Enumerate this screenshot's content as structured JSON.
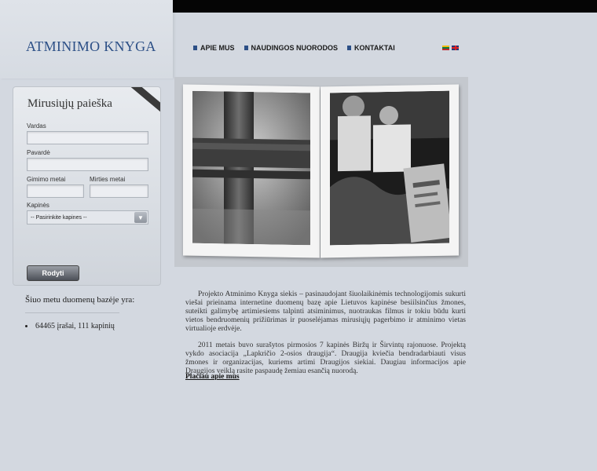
{
  "header": {
    "logo": "ATMINIMO KNYGA"
  },
  "nav": [
    {
      "label": "APIE MUS"
    },
    {
      "label": "NAUDINGOS NUORODOS"
    },
    {
      "label": "KONTAKTAI"
    }
  ],
  "languages": [
    "lt-flag-icon",
    "en-flag-icon"
  ],
  "search": {
    "title": "Mirusiųjų paieška",
    "fields": {
      "first_name_label": "Vardas",
      "last_name_label": "Pavardė",
      "birth_year_label": "Gimimo metai",
      "death_year_label": "Mirties metai",
      "cemetery_label": "Kapinės"
    },
    "cemetery_selected": "-- Pasirinkite kapines --",
    "submit_label": "Rodyti"
  },
  "stats": {
    "intro": "Šiuo metu duomenų bazėje yra:",
    "item": "64465 įrašai, 111 kapinių"
  },
  "content": {
    "paragraph1": "Projekto Atminimo Knyga siekis – pasinaudojant šiuolaikinėmis technologijomis sukurti viešai prieinama internetine duomenų bazę apie Lietuvos kapinėse besiilsinčius žmones, suteikti galimybę artimiesiems talpinti atsiminimus, nuotraukas filmus ir tokiu būdu kurti vietos bendruomenių prižiūrimas ir puoselėjamas mirusiųjų pagerbimo ir atminimo vietas virtualioje erdvėje.",
    "paragraph2": "2011 metais buvo surašytos pirmosios 7 kapinės Biržų ir Širvintų rajonuose. Projektą vykdo asociacija „Lapkričio 2-osios draugija“. Draugija kviečia bendradarbiauti visus žmones ir organizacijas, kuriems artimi Draugijos siekiai. Daugiau informacijos apie Draugijos veiklą rasite paspaudę žemiau esančią nuorodą.",
    "more_link": "Plačiau apie mus"
  }
}
